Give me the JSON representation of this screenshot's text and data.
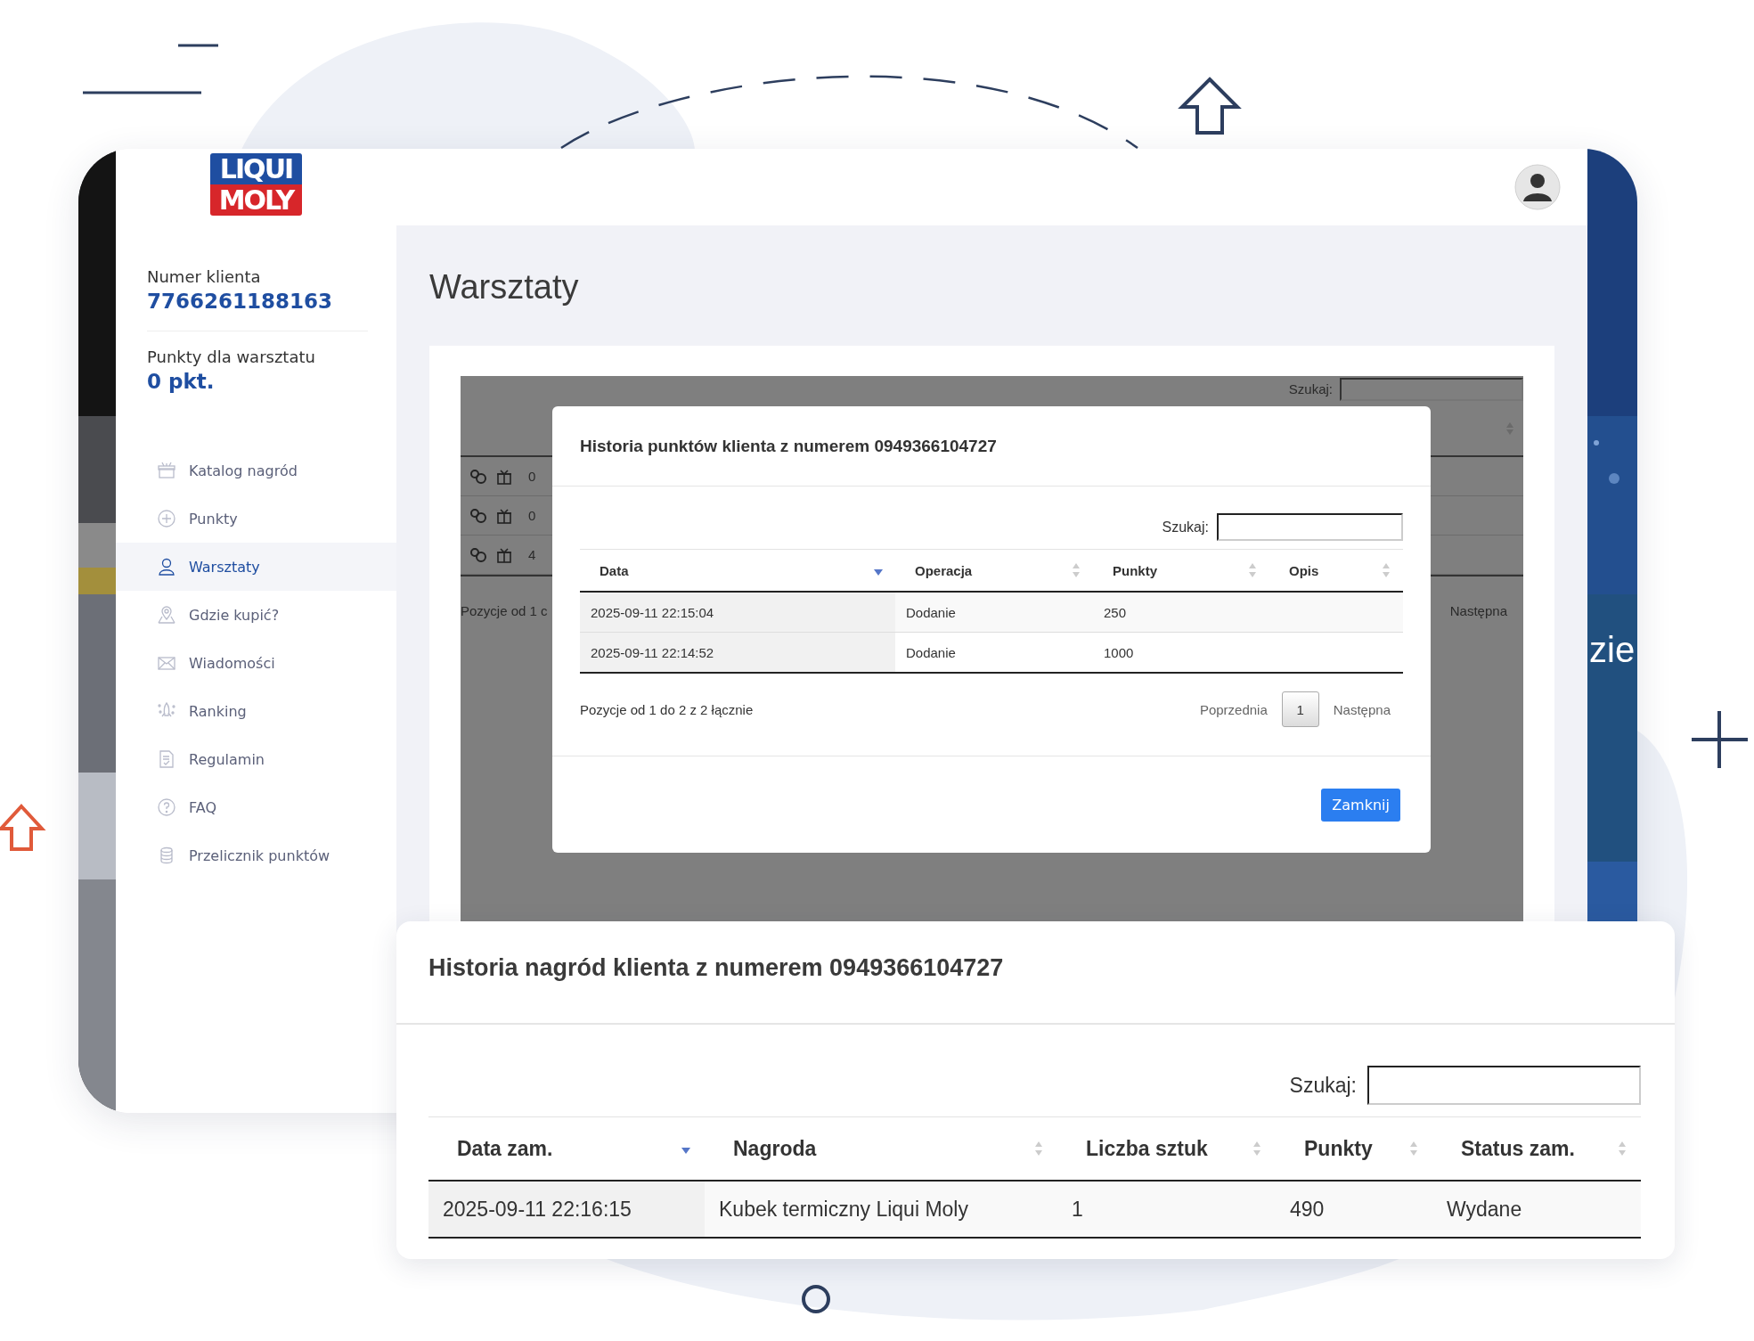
{
  "sidebar": {
    "logo": {
      "line1": "LIQUI",
      "line2": "MOLY"
    },
    "client_number_label": "Numer klienta",
    "client_number": "7766261188163",
    "points_label": "Punkty dla warsztatu",
    "points": "0 pkt.",
    "menu": [
      {
        "label": "Katalog nagród",
        "selected": false
      },
      {
        "label": "Punkty",
        "selected": false
      },
      {
        "label": "Warsztaty",
        "selected": true
      },
      {
        "label": "Gdzie kupić?",
        "selected": false
      },
      {
        "label": "Wiadomości",
        "selected": false
      },
      {
        "label": "Ranking",
        "selected": false
      },
      {
        "label": "Regulamin",
        "selected": false
      },
      {
        "label": "FAQ",
        "selected": false
      },
      {
        "label": "Przelicznik punktów",
        "selected": false
      }
    ]
  },
  "page": {
    "title": "Warsztaty"
  },
  "background_table": {
    "search_label": "Szukaj:",
    "rows": [
      {
        "cell": "0"
      },
      {
        "cell": "0"
      },
      {
        "cell": "4"
      }
    ],
    "info": "Pozycje od 1 c",
    "next": "Następna"
  },
  "banner": {
    "text": "zie"
  },
  "points_modal": {
    "title": "Historia punktów klienta z numerem 0949366104727",
    "search_label": "Szukaj:",
    "columns": [
      {
        "label": "Data",
        "sorted": true
      },
      {
        "label": "Operacja",
        "sorted": false
      },
      {
        "label": "Punkty",
        "sorted": false
      },
      {
        "label": "Opis",
        "sorted": false
      }
    ],
    "rows": [
      [
        "2025-09-11 22:15:04",
        "Dodanie",
        "250"
      ],
      [
        "2025-09-11 22:14:52",
        "Dodanie",
        "1000"
      ]
    ],
    "info": "Pozycje od 1 do 2 z 2 łącznie",
    "previous": "Poprzednia",
    "pages": [
      {
        "label": "1",
        "selected": true
      }
    ],
    "next": "Następna",
    "close_button": "Zamknij"
  },
  "rewards_panel": {
    "title": "Historia nagród klienta z numerem 0949366104727",
    "search_label": "Szukaj:",
    "columns": [
      {
        "label": "Data zam.",
        "sorted": true
      },
      {
        "label": "Nagroda",
        "sorted": false
      },
      {
        "label": "Liczba sztuk",
        "sorted": false
      },
      {
        "label": "Punkty",
        "sorted": false
      },
      {
        "label": "Status zam.",
        "sorted": false
      }
    ],
    "rows": [
      [
        "2025-09-11 22:16:15",
        "Kubek termiczny Liqui Moly",
        "1",
        "490",
        "Wydane"
      ]
    ]
  }
}
